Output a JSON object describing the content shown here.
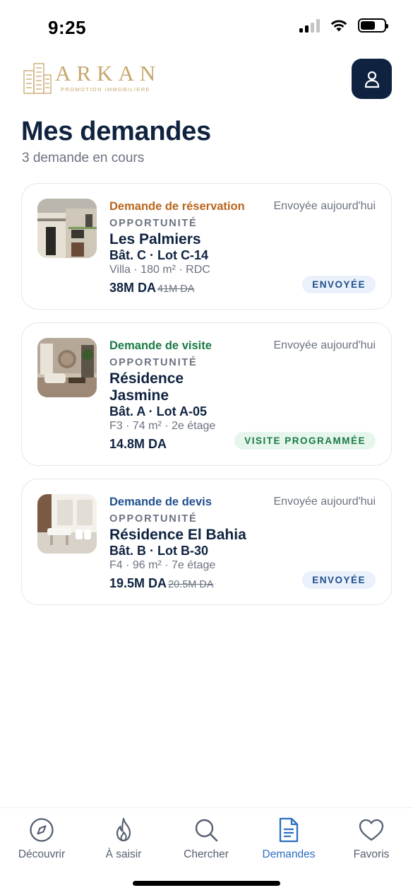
{
  "status_bar": {
    "time": "9:25"
  },
  "brand": {
    "name": "ARKAN",
    "tagline": "PROMOTION IMMOBILIERE"
  },
  "header": {
    "title": "Mes demandes",
    "subtitle": "3 demande en cours"
  },
  "requests": [
    {
      "type": "Demande de réservation",
      "type_color": "#b8661c",
      "sent": "Envoyée aujourd'hui",
      "kicker": "OPPORTUNITÉ",
      "name": "Les Palmiers",
      "lot": "Bât. C · Lot C-14",
      "specs": "Villa · 180 m² · RDC",
      "price": "38M DA",
      "old_price": " 41M DA",
      "status": "ENVOYÉE"
    },
    {
      "type": "Demande de visite",
      "type_color": "#1a7a45",
      "sent": "Envoyée aujourd'hui",
      "kicker": "OPPORTUNITÉ",
      "name_line1": "Résidence",
      "name_line2": "Jasmine",
      "lot": "Bât. A · Lot A-05",
      "specs": "F3 · 74 m² · 2e étage",
      "price": "14.8M DA",
      "status": "VISITE PROGRAMMÉE"
    },
    {
      "type": "Demande de devis",
      "type_color": "#1f4e8c",
      "sent": "Envoyée aujourd'hui",
      "kicker": "OPPORTUNITÉ",
      "name": "Résidence El Bahia",
      "lot": "Bât. B · Lot B-30",
      "specs": "F4 · 96 m² · 7e étage",
      "price": "19.5M DA",
      "old_price": " 20.5M DA",
      "status": "ENVOYÉE"
    }
  ],
  "nav": [
    {
      "label": "Découvrir",
      "icon": "compass-icon"
    },
    {
      "label": "À saisir",
      "icon": "flame-icon"
    },
    {
      "label": "Chercher",
      "icon": "search-icon"
    },
    {
      "label": "Demandes",
      "icon": "document-icon",
      "active": true
    },
    {
      "label": "Favoris",
      "icon": "heart-icon"
    }
  ],
  "colors": {
    "navy": "#0f2340",
    "gold": "#c6a76a",
    "accent": "#2d6fc0"
  }
}
